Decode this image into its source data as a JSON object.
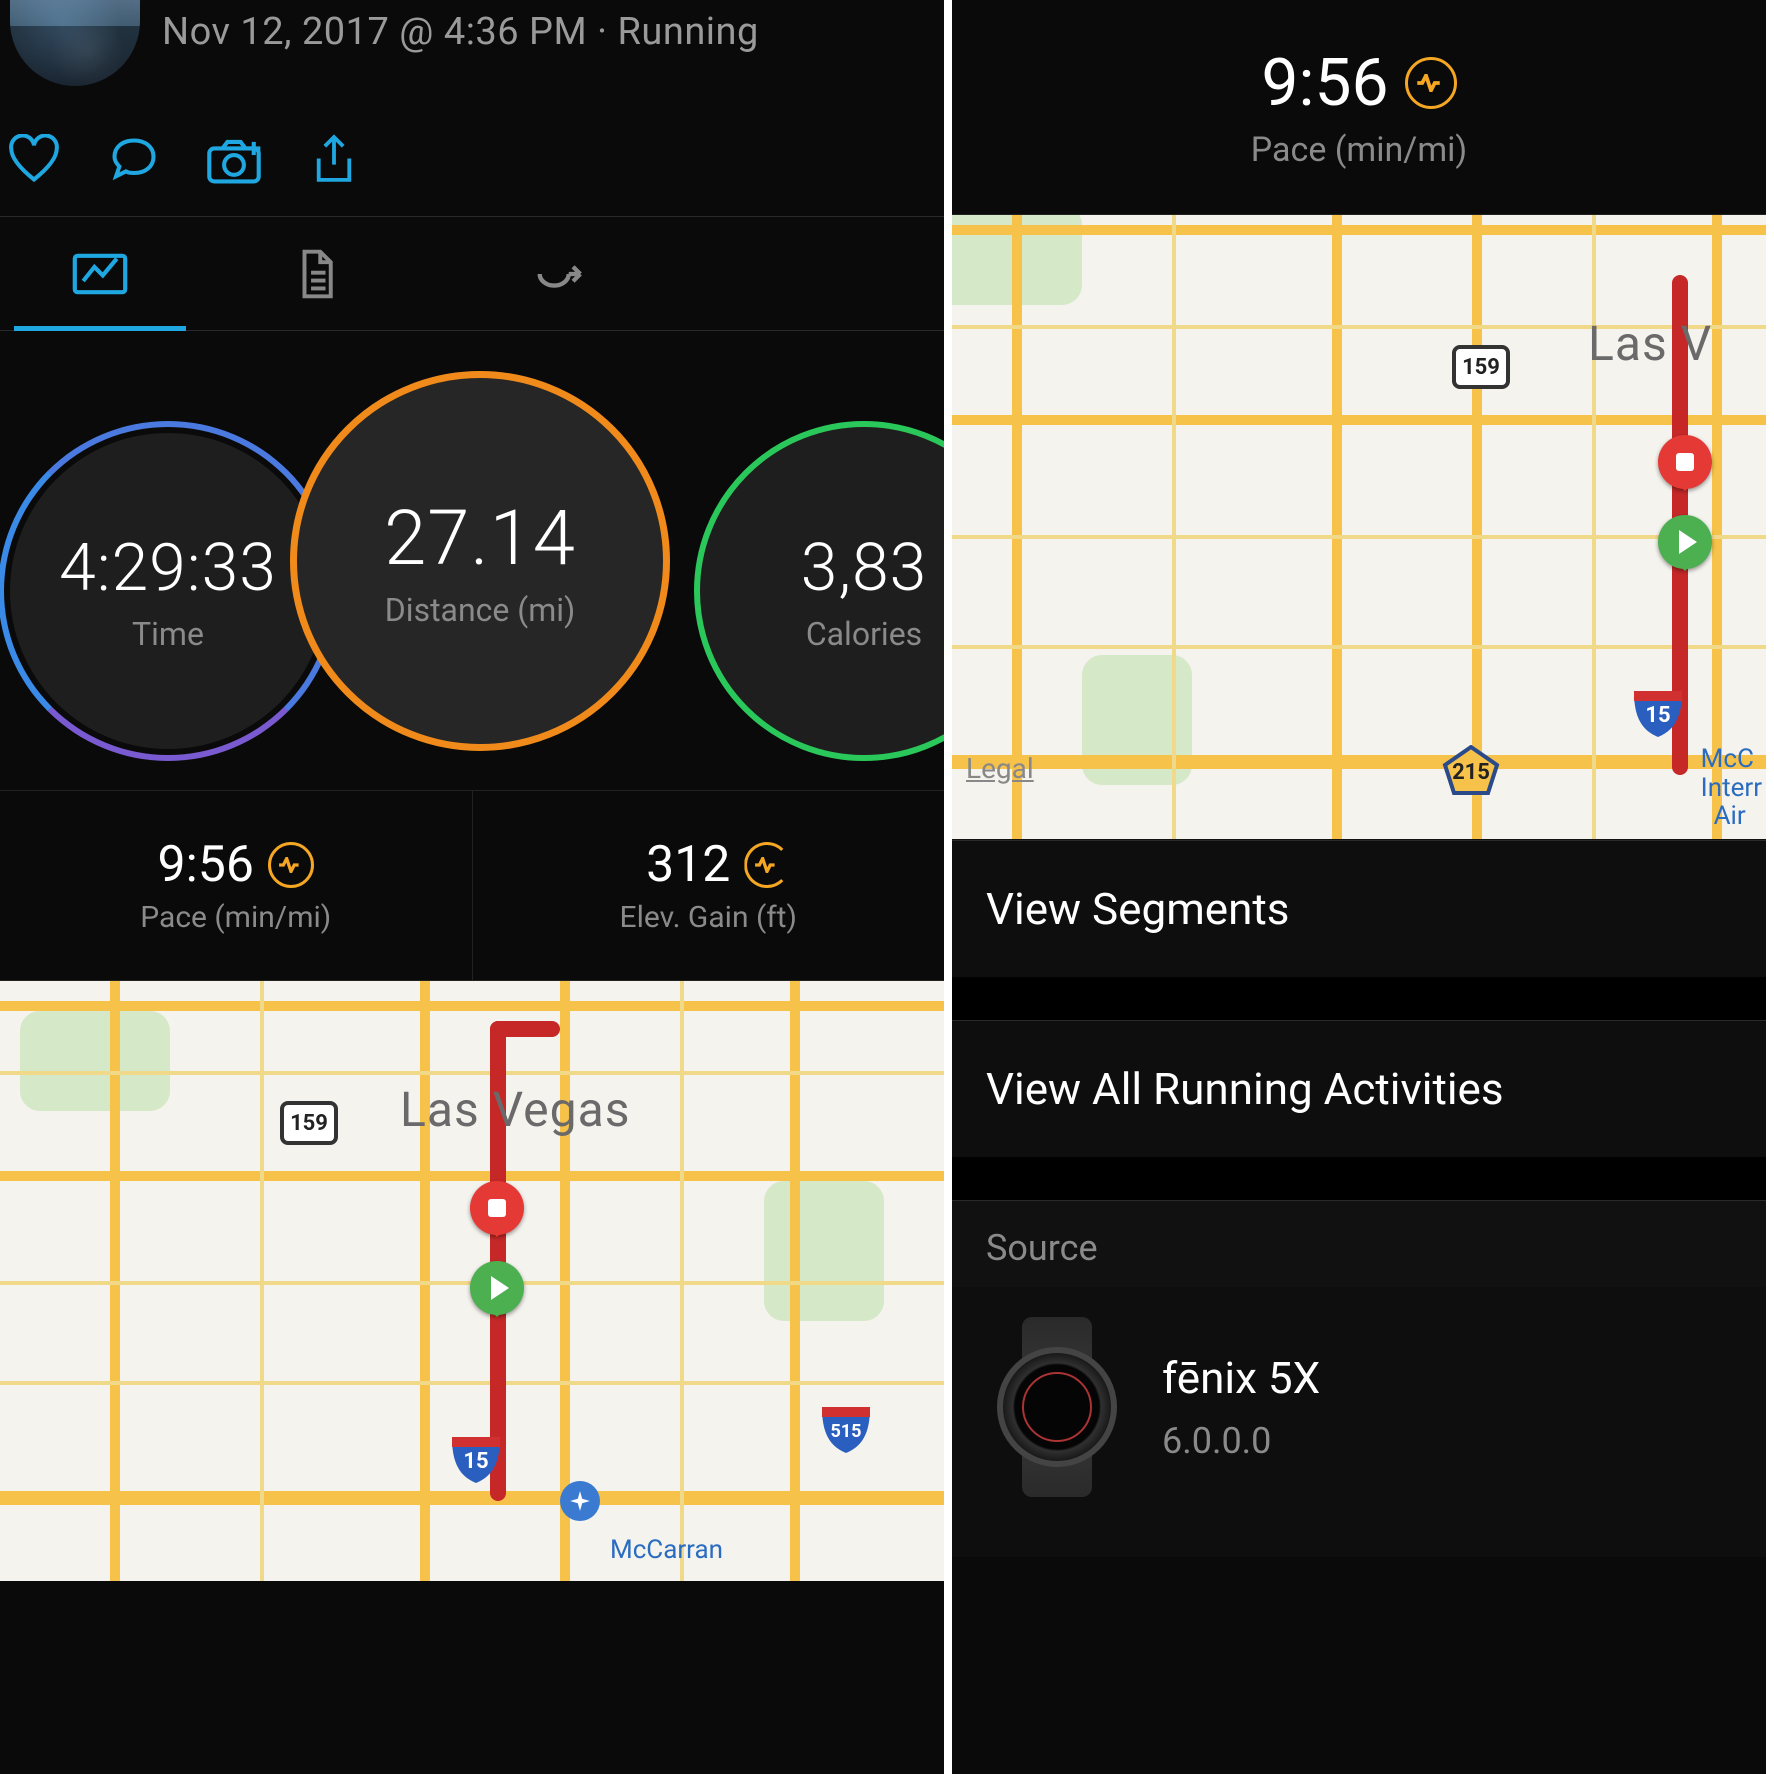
{
  "header": {
    "subtitle": "Nov 12, 2017 @ 4:36 PM · Running"
  },
  "rings": {
    "time": {
      "value": "4:29:33",
      "label": "Time"
    },
    "dist": {
      "value": "27.14",
      "label": "Distance (mi)"
    },
    "cal": {
      "value": "3,83",
      "label": "Calories"
    }
  },
  "stats": {
    "pace": {
      "value": "9:56",
      "label": "Pace (min/mi)"
    },
    "elev": {
      "value": "312",
      "label": "Elev. Gain (ft)"
    }
  },
  "map_left": {
    "city": "Las Vegas",
    "route159": "159",
    "i15": "15",
    "i515": "515",
    "poi": "McCarran"
  },
  "right_top": {
    "value": "9:56",
    "label": "Pace (min/mi)"
  },
  "map_right": {
    "city": "Las V",
    "route159": "159",
    "i15": "15",
    "pent215": "215",
    "legal": "Legal",
    "poi1": "McC",
    "poi2": "Interr",
    "poi3": "Air"
  },
  "list": {
    "segments": "View Segments",
    "all": "View All Running Activities"
  },
  "source": {
    "header": "Source",
    "device": "fēnix 5X",
    "version": "6.0.0.0"
  }
}
